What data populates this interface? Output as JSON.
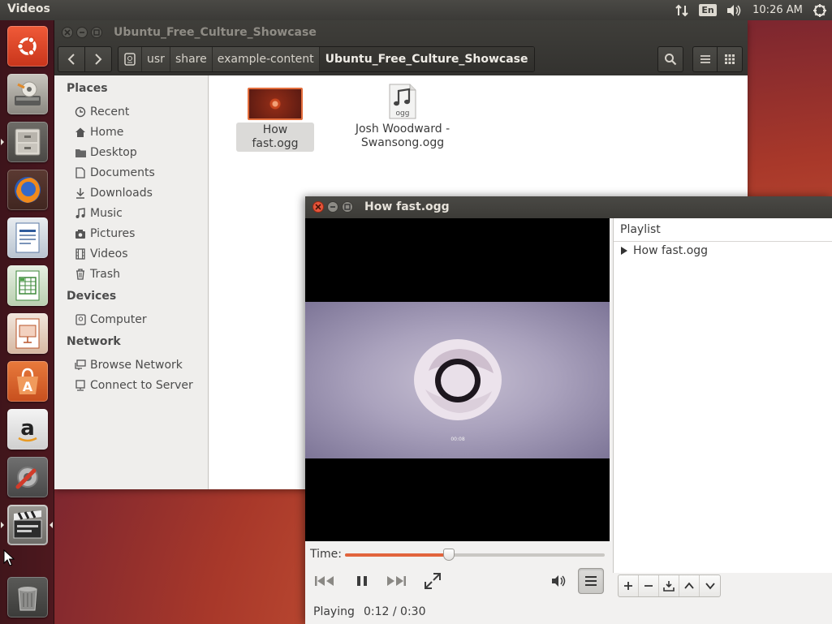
{
  "top_panel": {
    "app_title": "Videos",
    "keyboard_layout": "En",
    "clock": "10:26 AM"
  },
  "launcher": {
    "items": [
      {
        "name": "dash-home",
        "icon": "ubuntu-logo-icon"
      },
      {
        "name": "installer",
        "icon": "install-ubuntu-icon"
      },
      {
        "name": "files",
        "icon": "file-cabinet-icon",
        "running": true
      },
      {
        "name": "firefox",
        "icon": "firefox-icon"
      },
      {
        "name": "libreoffice-writer",
        "icon": "writer-icon"
      },
      {
        "name": "libreoffice-calc",
        "icon": "calc-icon"
      },
      {
        "name": "libreoffice-impress",
        "icon": "impress-icon"
      },
      {
        "name": "software-center",
        "icon": "software-center-icon"
      },
      {
        "name": "amazon",
        "icon": "amazon-icon"
      },
      {
        "name": "system-settings",
        "icon": "system-settings-icon"
      },
      {
        "name": "videos",
        "icon": "clapperboard-icon",
        "running": true,
        "focused": true
      },
      {
        "name": "trash",
        "icon": "trash-icon"
      }
    ]
  },
  "nautilus": {
    "title": "Ubuntu_Free_Culture_Showcase",
    "breadcrumbs": [
      "usr",
      "share",
      "example-content",
      "Ubuntu_Free_Culture_Showcase"
    ],
    "sidebar": {
      "places_header": "Places",
      "places": [
        "Recent",
        "Home",
        "Desktop",
        "Documents",
        "Downloads",
        "Music",
        "Pictures",
        "Videos",
        "Trash"
      ],
      "devices_header": "Devices",
      "devices": [
        "Computer"
      ],
      "network_header": "Network",
      "network": [
        "Browse Network",
        "Connect to Server"
      ]
    },
    "files": [
      {
        "name": "How fast.ogg",
        "selected": true
      },
      {
        "name_line1": "Josh Woodward -",
        "name_line2": "Swansong.ogg",
        "icon_label": "ogg"
      }
    ]
  },
  "totem": {
    "title": "How fast.ogg",
    "video_timestamp": "00:08",
    "playlist_header": "Playlist",
    "playlist_items": [
      "How fast.ogg"
    ],
    "time_label": "Time:",
    "progress": 0.4,
    "status": "Playing",
    "time_readout": "0:12 / 0:30",
    "accent_color": "#e2643c"
  }
}
